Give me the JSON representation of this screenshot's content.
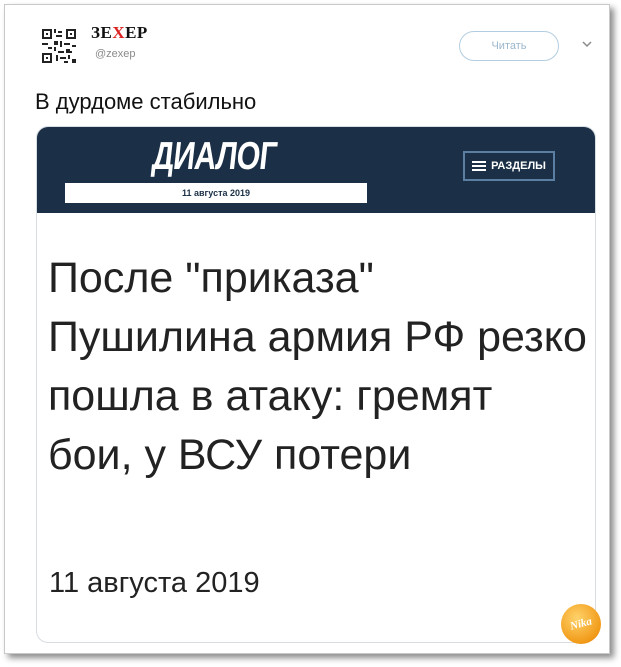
{
  "tweet": {
    "author_name_prefix": "ЗЕ",
    "author_name_x": "X",
    "author_name_suffix": "ЕР",
    "author_handle": "@zexep",
    "follow_label": "Читать",
    "text": "В дурдоме стабильно"
  },
  "card": {
    "logo": "ДИАЛОГ",
    "header_date": "11 августа 2019",
    "sections_label": "РАЗДЕЛЫ",
    "headline": "После \"приказа\" Пушилина армия РФ резко пошла в атаку: гремят бои, у ВСУ потери",
    "article_date": "11 августа 2019"
  },
  "watermark": {
    "text": "Nika"
  },
  "colors": {
    "header_bg": "#1b3046",
    "follow_border": "#b3cde0",
    "accent_x": "#dd2222"
  }
}
